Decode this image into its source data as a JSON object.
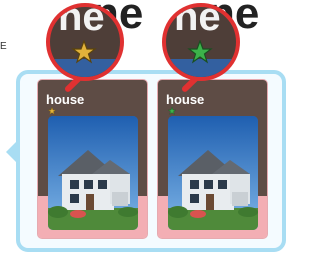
{
  "background": {
    "side_text": "E",
    "titles": [
      "ne",
      "ne"
    ]
  },
  "cards": [
    {
      "title": "house",
      "star_color": "#e2b23a",
      "star_icon": "star-icon-gold"
    },
    {
      "title": "house",
      "star_color": "#3cb24a",
      "star_icon": "star-icon-green"
    }
  ],
  "colors": {
    "panel_border": "#a8ddf3",
    "card_pink": "#f7c7ca",
    "card_dark": "#5e4c45",
    "zoom_ring": "#e03131",
    "sky": "#2d6db5"
  }
}
